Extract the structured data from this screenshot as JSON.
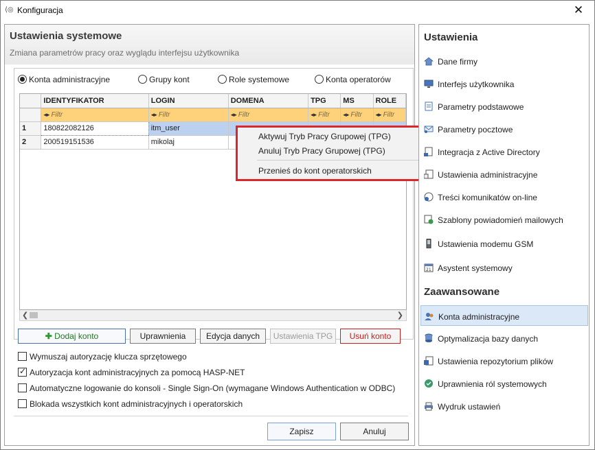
{
  "window": {
    "title": "Konfiguracja",
    "close": "✕"
  },
  "left": {
    "title": "Ustawienia systemowe",
    "subtitle": "Zmiana parametrów pracy oraz wyglądu interfejsu użytkownika",
    "radios": [
      "Konta administracyjne",
      "Grupy kont",
      "Role systemowe",
      "Konta operatorów"
    ],
    "selected_radio": "Konta administracyjne",
    "grid": {
      "columns": [
        "IDENTYFIKATOR",
        "LOGIN",
        "DOMENA",
        "TPG",
        "MS",
        "ROLE"
      ],
      "filter_placeholder": "Filtr",
      "rows": [
        {
          "num": "1",
          "id": "180822082126",
          "login": "itm_user",
          "domain": "",
          "tpg": "",
          "ms": "",
          "role": ""
        },
        {
          "num": "2",
          "id": "200519151536",
          "login": "mikolaj",
          "domain": "",
          "tpg": "",
          "ms": "",
          "role": ""
        }
      ]
    },
    "buttons": {
      "add": "Dodaj konto",
      "permissions": "Uprawnienia",
      "edit": "Edycja danych",
      "tpg_settings": "Ustawienia TPG",
      "delete": "Usuń konto"
    },
    "checks": [
      {
        "label": "Wymuszaj autoryzację klucza sprzętowego",
        "checked": false
      },
      {
        "label": "Autoryzacja kont administracyjnych za pomocą HASP-NET",
        "checked": true
      },
      {
        "label": "Automatyczne logowanie do konsoli - Single Sign-On (wymagane Windows Authentication w ODBC)",
        "checked": false
      },
      {
        "label": "Blokada wszystkich kont administracyjnych i operatorskich",
        "checked": false
      }
    ],
    "save": "Zapisz",
    "cancel": "Anuluj"
  },
  "context_menu": {
    "items": [
      "Aktywuj Tryb Pracy Grupowej (TPG)",
      "Anuluj Tryb Pracy Grupowej (TPG)",
      "Przenieś do kont operatorskich"
    ]
  },
  "right": {
    "section1": "Ustawienia",
    "items1": [
      {
        "label": "Dane firmy",
        "icon": "home-icon"
      },
      {
        "label": "Interfejs użytkownika",
        "icon": "monitor-icon"
      },
      {
        "label": "Parametry podstawowe",
        "icon": "settings-doc-icon"
      },
      {
        "label": "Parametry pocztowe",
        "icon": "mail-icon"
      },
      {
        "label": "Integracja z Active Directory",
        "icon": "directory-icon"
      },
      {
        "label": "Ustawienia administracyjne",
        "icon": "admin-doc-icon"
      },
      {
        "label": "Treści komunikatów on-line",
        "icon": "message-icon"
      },
      {
        "label": "Szablony powiadomień mailowych",
        "icon": "template-icon"
      },
      {
        "label": "Ustawienia modemu GSM",
        "icon": "phone-icon"
      },
      {
        "label": "Asystent systemowy",
        "icon": "calendar-icon"
      }
    ],
    "section2": "Zaawansowane",
    "items2": [
      {
        "label": "Konta administracyjne",
        "icon": "users-icon"
      },
      {
        "label": "Optymalizacja bazy danych",
        "icon": "database-icon"
      },
      {
        "label": "Ustawienia repozytorium plików",
        "icon": "repository-icon"
      },
      {
        "label": "Uprawnienia ról systemowych",
        "icon": "roles-icon"
      },
      {
        "label": "Wydruk ustawień",
        "icon": "print-icon"
      }
    ],
    "active": "Konta administracyjne"
  },
  "colors": {
    "accent": "#d9272a",
    "selection": "#bcd1ef",
    "filter_row": "#fdd27a",
    "active_nav": "#dbe8f7"
  }
}
